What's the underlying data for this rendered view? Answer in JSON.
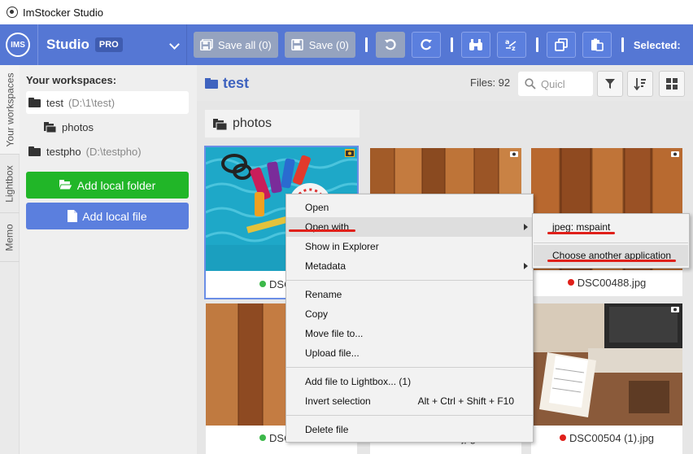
{
  "app": {
    "window_title": "ImStocker Studio"
  },
  "header": {
    "avatar_text": "IMS",
    "studio_label": "Studio",
    "pro_badge": "PRO",
    "save_all_label": "Save all (0)",
    "save_label": "Save (0)",
    "selected_label": "Selected:"
  },
  "vtabs": [
    "Your workspaces",
    "Lightbox",
    "Memo"
  ],
  "sidebar": {
    "title": "Your workspaces:",
    "items": [
      {
        "name": "test",
        "path": "(D:\\1\\test)"
      },
      {
        "name": "photos",
        "path": ""
      },
      {
        "name": "testpho",
        "path": "(D:\\testpho)"
      }
    ],
    "add_folder_label": "Add local folder",
    "add_file_label": "Add local file"
  },
  "main": {
    "workspace_name": "test",
    "files_count": "Files: 92",
    "search_placeholder": "Quicl",
    "folder_chip": "photos"
  },
  "cards": [
    {
      "caption": "DSC00",
      "status": "green"
    },
    {
      "caption": "",
      "status": ""
    },
    {
      "caption": "DSC00488.jpg",
      "status": "red"
    },
    {
      "caption": "DSC00",
      "status": "green"
    },
    {
      "caption": "jpg",
      "status": ""
    },
    {
      "caption": "DSC00504 (1).jpg",
      "status": "red"
    }
  ],
  "context_menu": {
    "open": "Open",
    "open_with": "Open with",
    "show_in_explorer": "Show in Explorer",
    "metadata": "Metadata",
    "rename": "Rename",
    "copy": "Copy",
    "move_file_to": "Move file to...",
    "upload_file": "Upload file...",
    "add_to_lightbox": "Add file to Lightbox... (1)",
    "invert_selection": "Invert selection",
    "invert_shortcut": "Alt + Ctrl + Shift + F10",
    "delete_file": "Delete file"
  },
  "submenu": {
    "mspaint": "jpeg: mspaint",
    "choose_another": "Choose another application"
  },
  "colors": {
    "header_blue": "#5577d4",
    "accent_green": "#21b628",
    "accent_blue": "#5b7fde",
    "status_green": "#3cb84a",
    "status_red": "#e0201a",
    "highlight_red": "#e0201a"
  }
}
